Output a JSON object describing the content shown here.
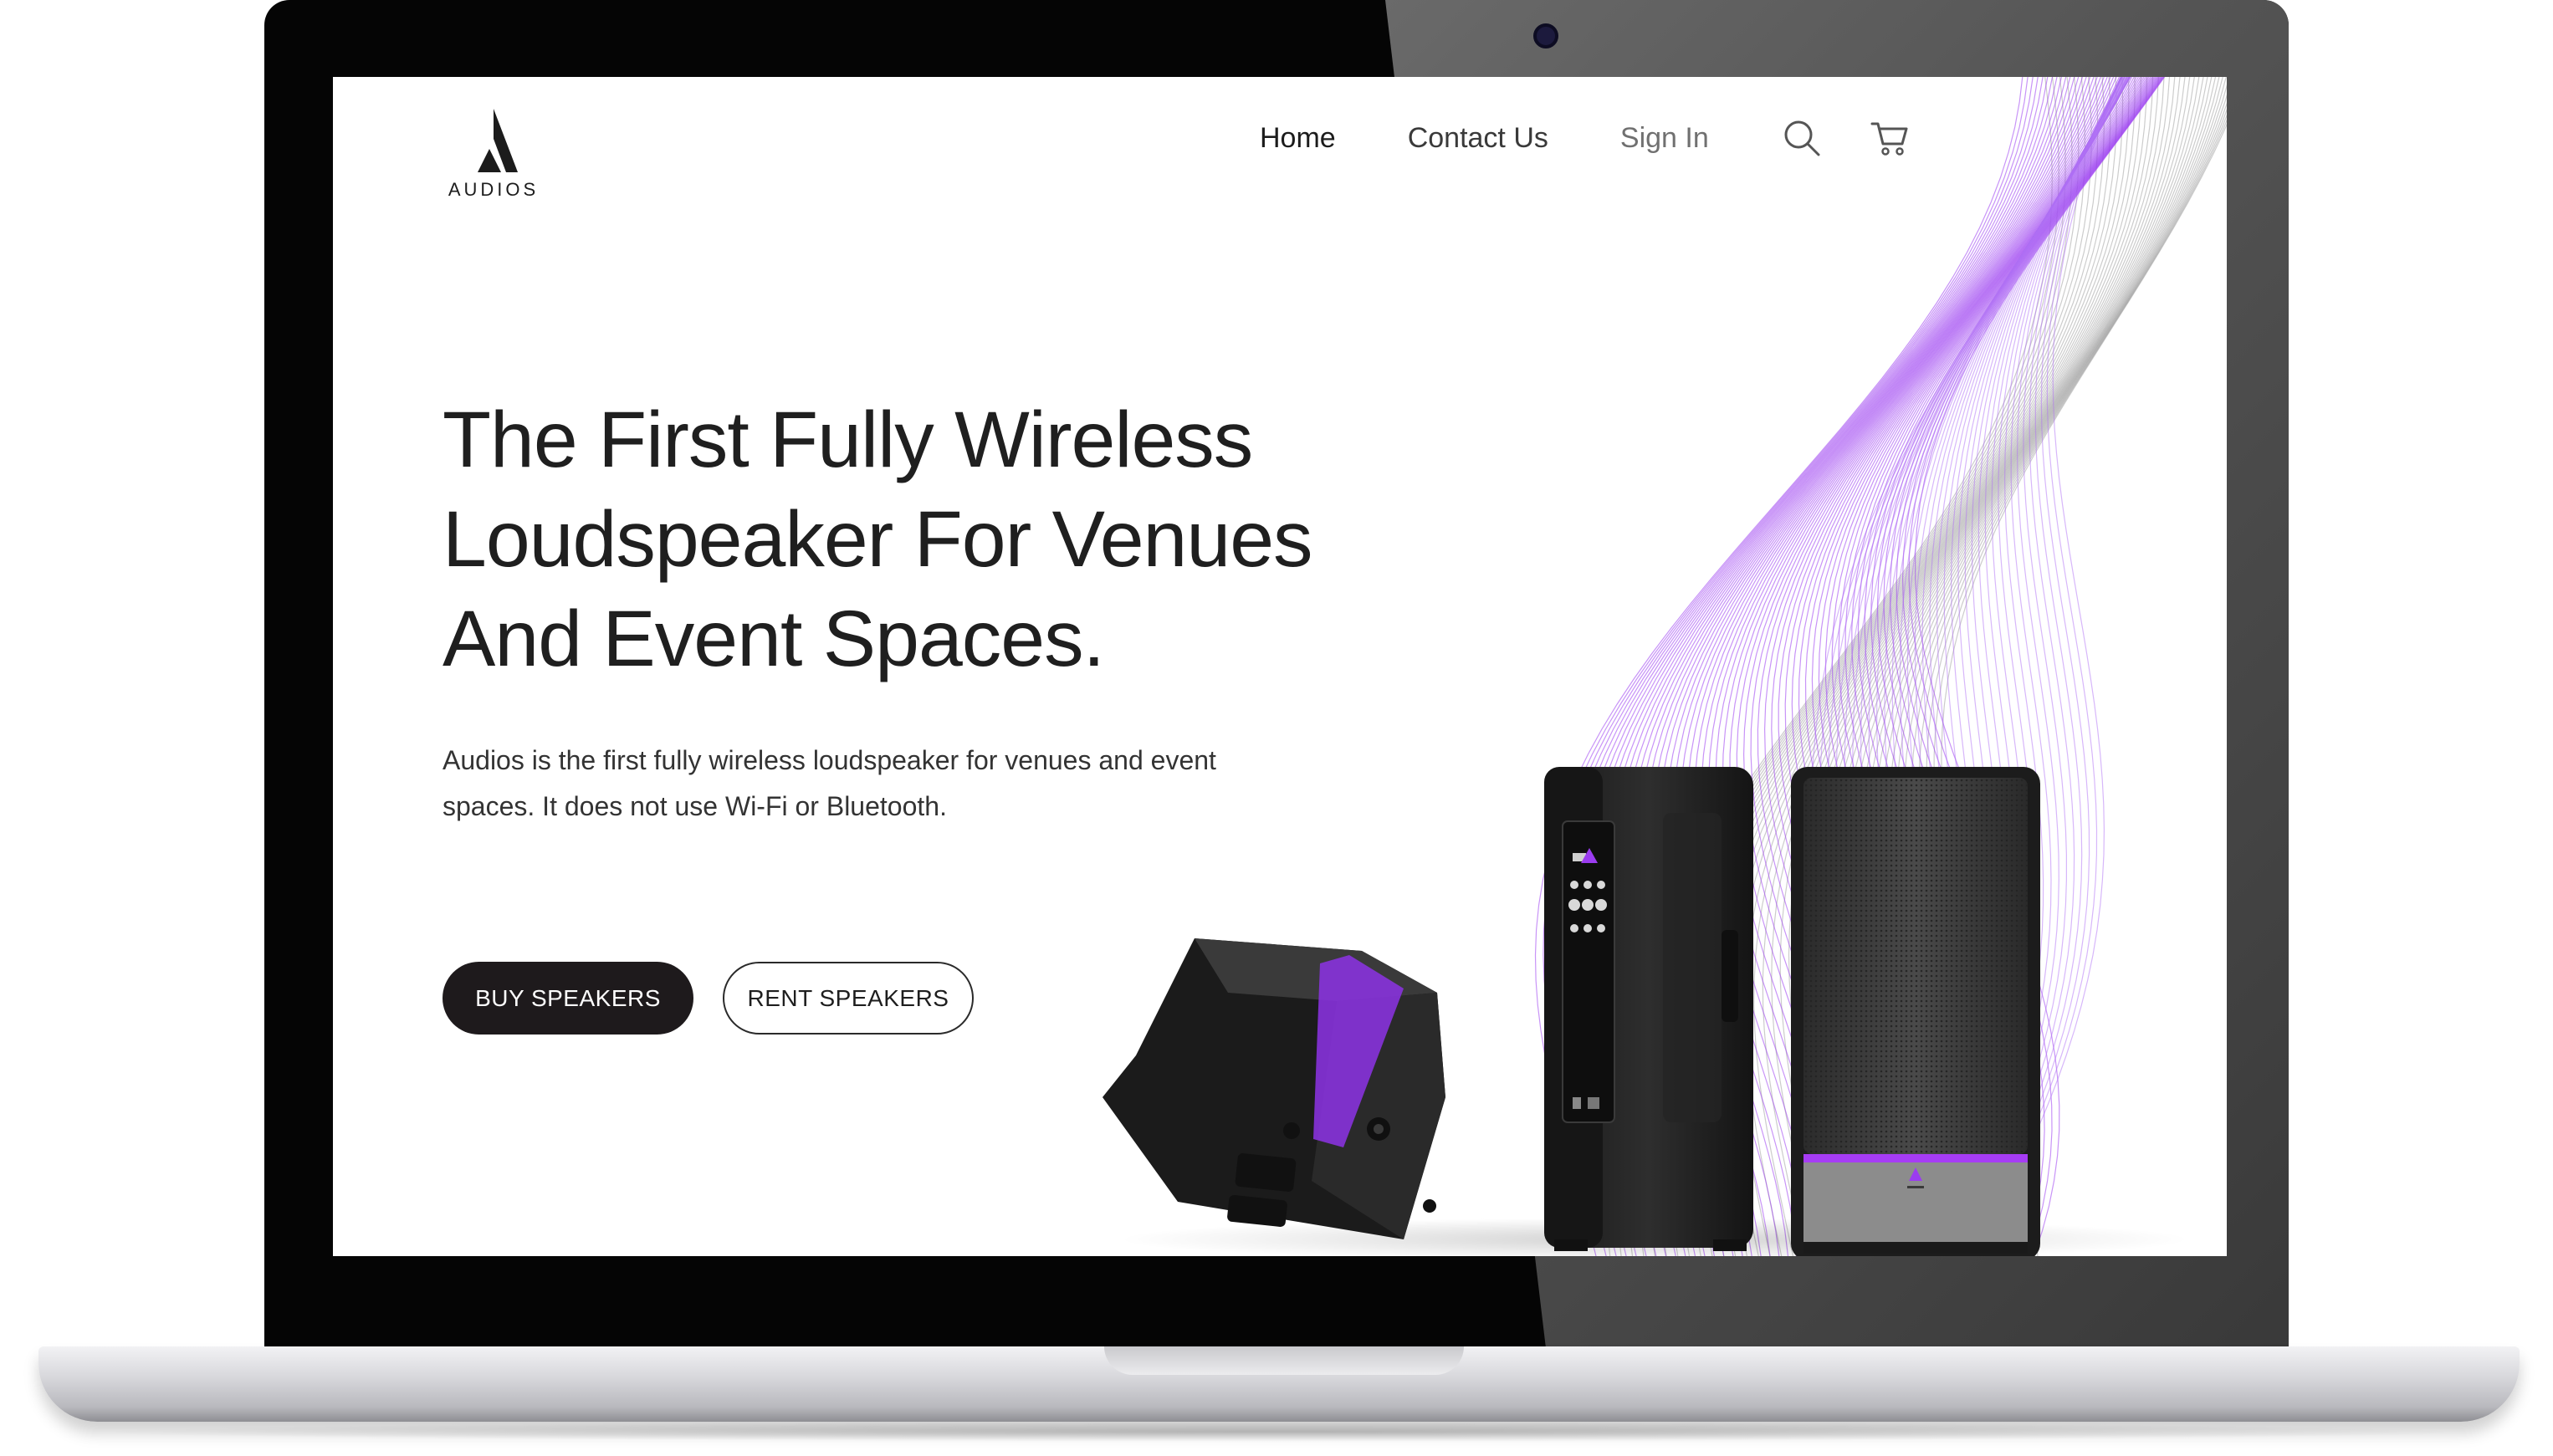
{
  "brand": {
    "logo_text": "AUDIOS"
  },
  "nav": {
    "links": [
      "Home",
      "Contact Us",
      "Sign In"
    ]
  },
  "hero": {
    "headline_lines": [
      "The First Fully Wireless",
      "Loudspeaker For Venues",
      "And Event Spaces."
    ],
    "description_lines": [
      "Audios is the first fully wireless loudspeaker for venues and event",
      "spaces. It does not use Wi-Fi or Bluetooth."
    ],
    "buy_label": "BUY SPEAKERS",
    "rent_label": "RENT SPEAKERS"
  },
  "icons": {
    "search": "search-icon",
    "cart": "cart-icon",
    "logo": "audios-logo-icon"
  },
  "colors": {
    "accent": "#9b3cf0",
    "dark": "#1e1a1c",
    "text": "#1f1f1f"
  }
}
